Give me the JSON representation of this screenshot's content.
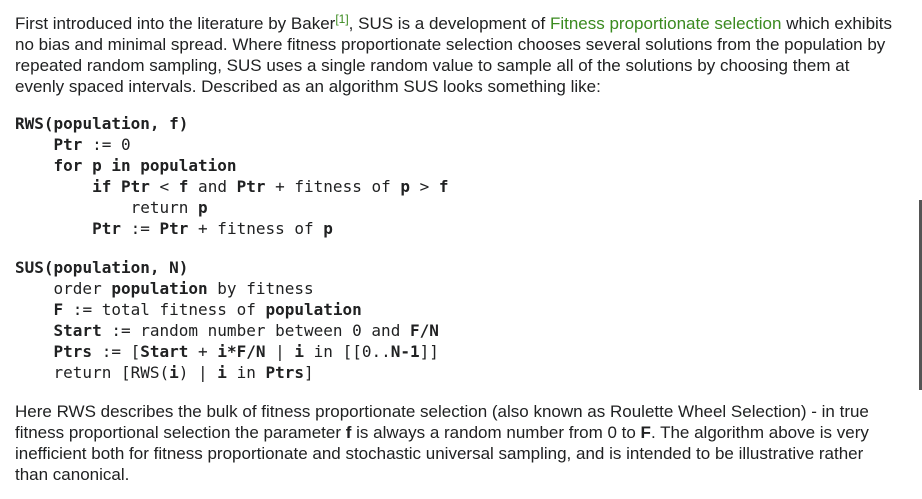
{
  "intro": {
    "before_author": "First introduced into the literature by Baker",
    "citation": "[1]",
    "after_citation": ", SUS is a development of ",
    "link_text": "Fitness proportionate selection",
    "rest": " which exhibits no bias and minimal spread. Where fitness proportionate selection chooses several solutions from the population by repeated random sampling, SUS uses a single random value to sample all of the solutions by choosing them at evenly spaced intervals. Described as an algorithm SUS looks something like:"
  },
  "code_rws": {
    "l1_name": "RWS",
    "l1_args": "(population, f)",
    "l2_var": "Ptr",
    "l2_rest": " := 0",
    "l3_for": "for p in population",
    "l4_if": "if ",
    "l4_ptr": "Ptr",
    "l4_lt": " < ",
    "l4_f": "f",
    "l4_and": " and ",
    "l4_ptr2": "Ptr",
    "l4_fit": " + fitness of ",
    "l4_p": "p",
    "l4_gt": " > ",
    "l4_f2": "f",
    "l5_ret": "return ",
    "l5_p": "p",
    "l6_ptr": "Ptr",
    "l6_mid": " := ",
    "l6_ptr2": "Ptr",
    "l6_rest": " + fitness of ",
    "l6_p": "p"
  },
  "code_sus": {
    "l1_name": "SUS",
    "l1_args": "(population, N)",
    "l2_a": "order ",
    "l2_b": "population",
    "l2_c": " by fitness",
    "l3_a": "F",
    "l3_b": " := total fitness of ",
    "l3_c": "population",
    "l4_a": "Start",
    "l4_b": " := random number between 0 and ",
    "l4_c": "F/N",
    "l5_a": "Ptrs",
    "l5_b": " := [",
    "l5_c": "Start",
    "l5_d": " + ",
    "l5_e": "i*F/N",
    "l5_f": " | ",
    "l5_g": "i",
    "l5_h": " in [[0..",
    "l5_i": "N-1",
    "l5_j": "]]",
    "l6_a": "return [RWS(",
    "l6_b": "i",
    "l6_c": ") | ",
    "l6_d": "i",
    "l6_e": " in ",
    "l6_f": "Ptrs",
    "l6_g": "]"
  },
  "outro": {
    "part1": "Here RWS describes the bulk of fitness proportionate selection (also known as Roulette Wheel Selection) - in true fitness proportional selection the parameter ",
    "param_f": "f",
    "part2": " is always a random number from 0 to ",
    "param_F": "F",
    "part3": ". The algorithm above is very inefficient both for fitness proportionate and stochastic universal sampling, and is intended to be illustrative rather than canonical."
  }
}
